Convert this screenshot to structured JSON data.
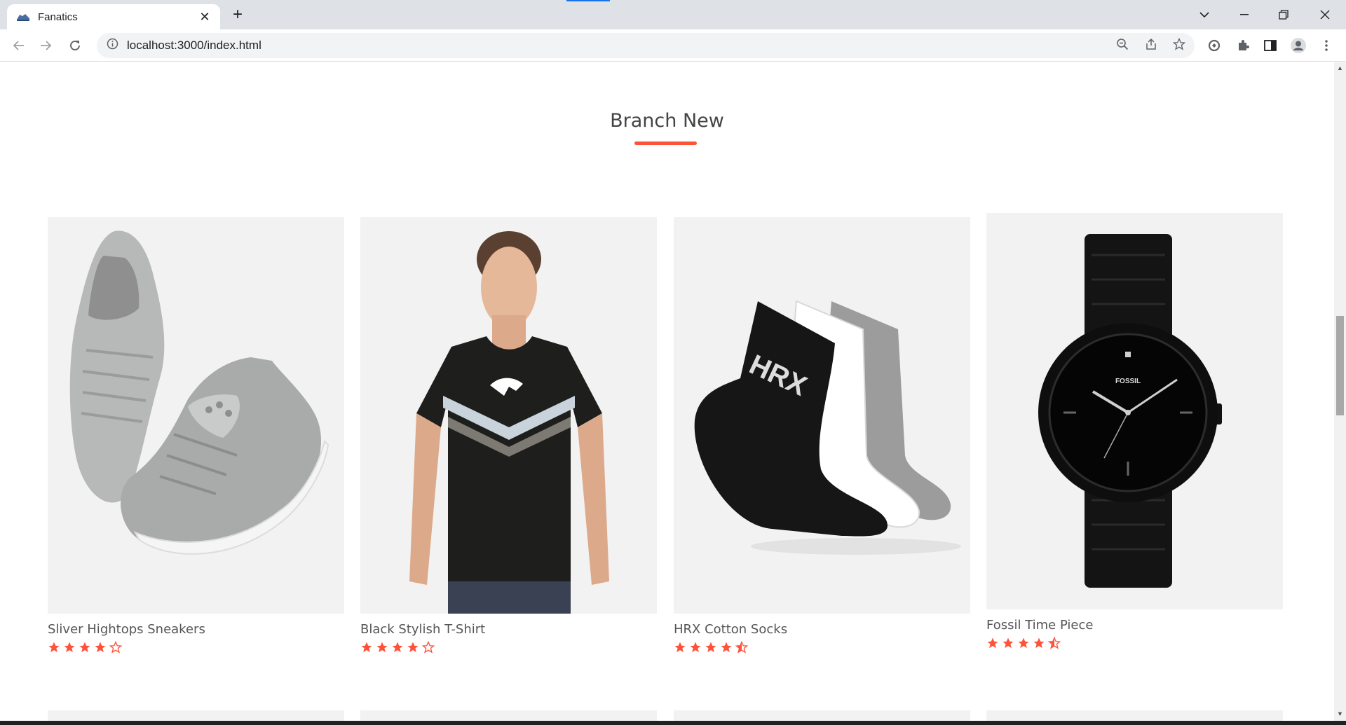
{
  "browser": {
    "tab_title": "Fanatics",
    "url": "localhost:3000/index.html"
  },
  "section": {
    "title": "Branch New",
    "accent_color": "#ff523b"
  },
  "products": [
    {
      "name": "Sliver Hightops Sneakers",
      "rating": 4,
      "image_icon": "sneakers-image"
    },
    {
      "name": "Black Stylish T-Shirt",
      "rating": 4,
      "image_icon": "tshirt-image"
    },
    {
      "name": "HRX Cotton Socks",
      "rating": 4.5,
      "image_icon": "socks-image",
      "image_text": "HRX"
    },
    {
      "name": "Fossil Time Piece",
      "rating": 4.5,
      "image_icon": "watch-image",
      "image_text": "FOSSIL"
    }
  ]
}
